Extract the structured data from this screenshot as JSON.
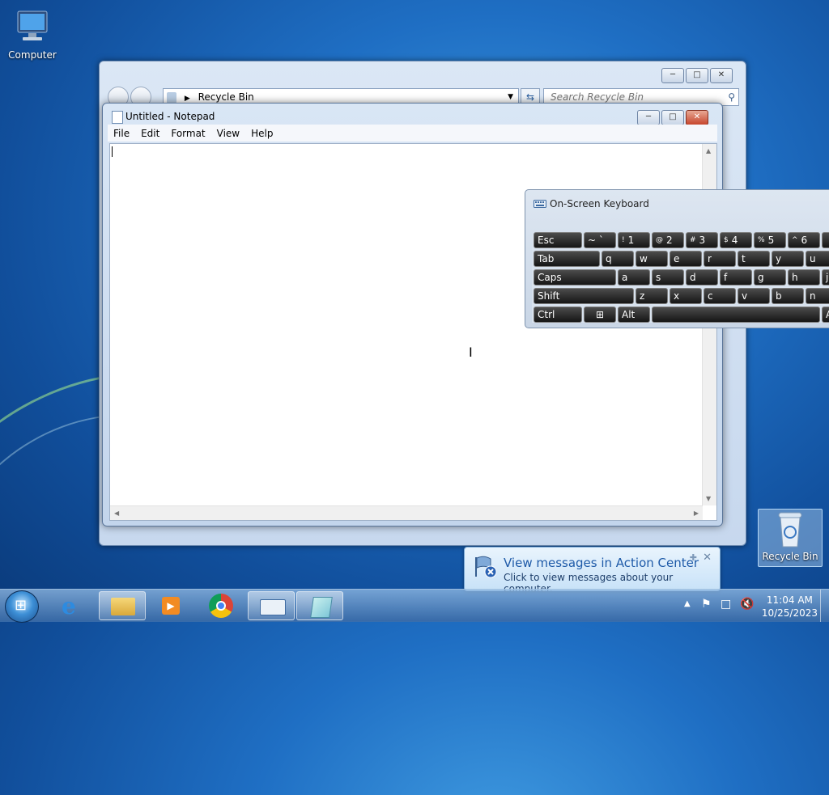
{
  "desktop": {
    "computer_label": "Computer",
    "recycle_bin_label": "Recycle Bin"
  },
  "explorer": {
    "address": "Recycle Bin",
    "search_placeholder": "Search Recycle Bin"
  },
  "notepad": {
    "title": "Untitled - Notepad",
    "menu": [
      "File",
      "Edit",
      "Format",
      "View",
      "Help"
    ]
  },
  "osk": {
    "title": "On-Screen Keyboard",
    "keys": {
      "esc": "Esc",
      "tilde": "~ `",
      "k1": "1",
      "k1s": "!",
      "k2": "2",
      "k2s": "@",
      "k3": "3",
      "k3s": "#",
      "k4": "4",
      "k4s": "$",
      "k5": "5",
      "k5s": "%",
      "k6": "6",
      "k6s": "^",
      "tab": "Tab",
      "q": "q",
      "w": "w",
      "e": "e",
      "r": "r",
      "t": "t",
      "y": "y",
      "u": "u",
      "caps": "Caps",
      "a": "a",
      "s": "s",
      "d": "d",
      "f": "f",
      "g": "g",
      "h": "h",
      "j": "j",
      "shift": "Shift",
      "z": "z",
      "x": "x",
      "c": "c",
      "v": "v",
      "b": "b",
      "n": "n",
      "ctrl": "Ctrl",
      "alt": "Alt",
      "altgr": "A"
    }
  },
  "balloon": {
    "heading": "View messages in Action Center",
    "subtext": "Click to view messages about your computer."
  },
  "taskbar": {
    "time": "11:04 AM",
    "date": "10/25/2023"
  }
}
